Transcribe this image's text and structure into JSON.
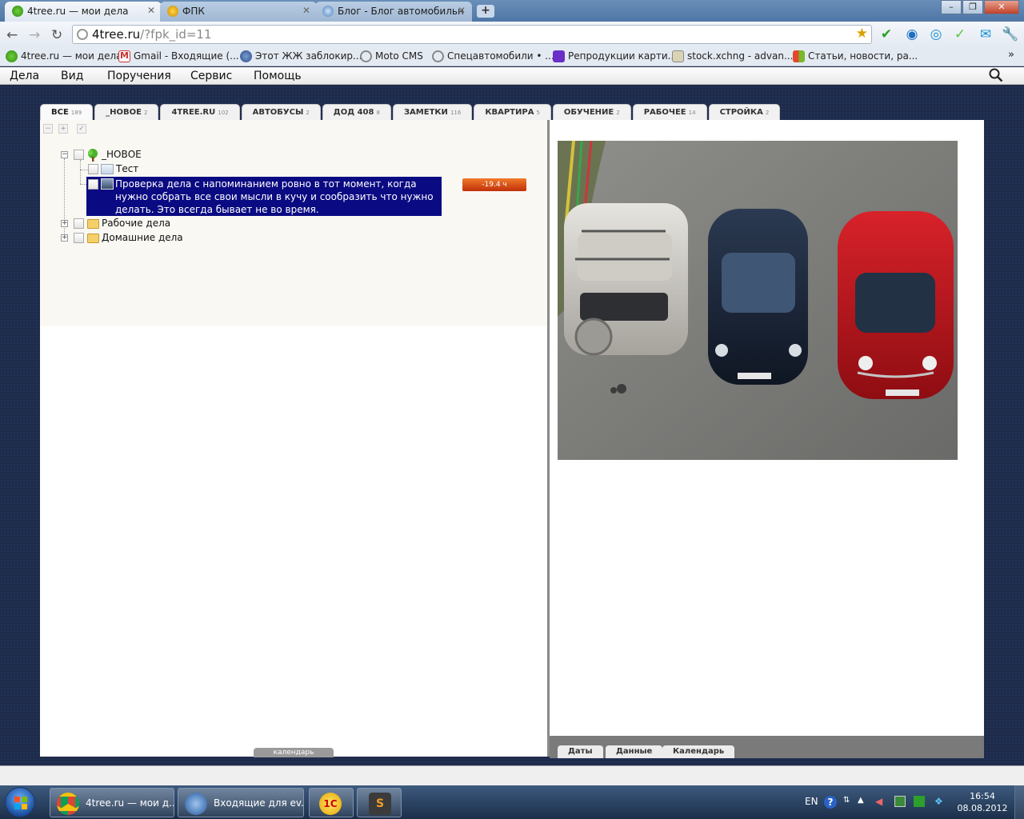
{
  "browser": {
    "tabs": [
      {
        "title": "4tree.ru — мои дела",
        "icon": "tree-icon"
      },
      {
        "title": "ФПК",
        "icon": "fpk-icon"
      },
      {
        "title": "Блог - Блог автомобильн",
        "icon": "blog-icon"
      }
    ],
    "address": {
      "domain": "4tree.ru",
      "path": "/?fpk_id=11"
    },
    "bookmarks": [
      "4tree.ru — мои дела",
      "Gmail - Входящие (...",
      "Этот ЖЖ заблокир...",
      "Moto CMS",
      "Спецавтомобили • ...",
      "Репродукции карти...",
      "stock.xchng - advan...",
      "Статьи, новости, ра..."
    ],
    "bookmarks_more": "»"
  },
  "app": {
    "menu": [
      "Дела",
      "Вид",
      "Поручения",
      "Сервис",
      "Помощь"
    ],
    "tabs": [
      {
        "label": "ВСЕ",
        "count": "189"
      },
      {
        "label": "_НОВОЕ",
        "count": "2"
      },
      {
        "label": "4TREE.RU",
        "count": "102"
      },
      {
        "label": "АВТОБУСЫ",
        "count": "2"
      },
      {
        "label": "ДОД 408",
        "count": "8"
      },
      {
        "label": "ЗАМЕТКИ",
        "count": "116"
      },
      {
        "label": "КВАРТИРА",
        "count": "5"
      },
      {
        "label": "ОБУЧЕНИЕ",
        "count": "2"
      },
      {
        "label": "РАБОЧЕЕ",
        "count": "14"
      },
      {
        "label": "СТРОЙКА",
        "count": "2"
      }
    ],
    "tree": {
      "root": "_НОВОЕ",
      "child_test": "Тест",
      "selected_task": "Проверка дела с напоминанием ровно в тот момент, когда нужно собрать все свои мысли в кучу и сообразить что нужно делать. Это всегда бывает не во время.",
      "deadline": "-19.4 ч",
      "folder_work": "Рабочие дела",
      "folder_home": "Домашние дела"
    },
    "calendar_tab": "календарь",
    "right_tabs": [
      "Даты",
      "Данные",
      "Календарь"
    ]
  },
  "taskbar": {
    "buttons": [
      "4tree.ru — мои д...",
      "Входящие для ev..."
    ],
    "lang": "EN",
    "time": "16:54",
    "date": "08.08.2012"
  },
  "colors": {
    "selection": "#0a0a82",
    "deadline": "#d94a14",
    "app_bg": "#1e2b4a"
  }
}
